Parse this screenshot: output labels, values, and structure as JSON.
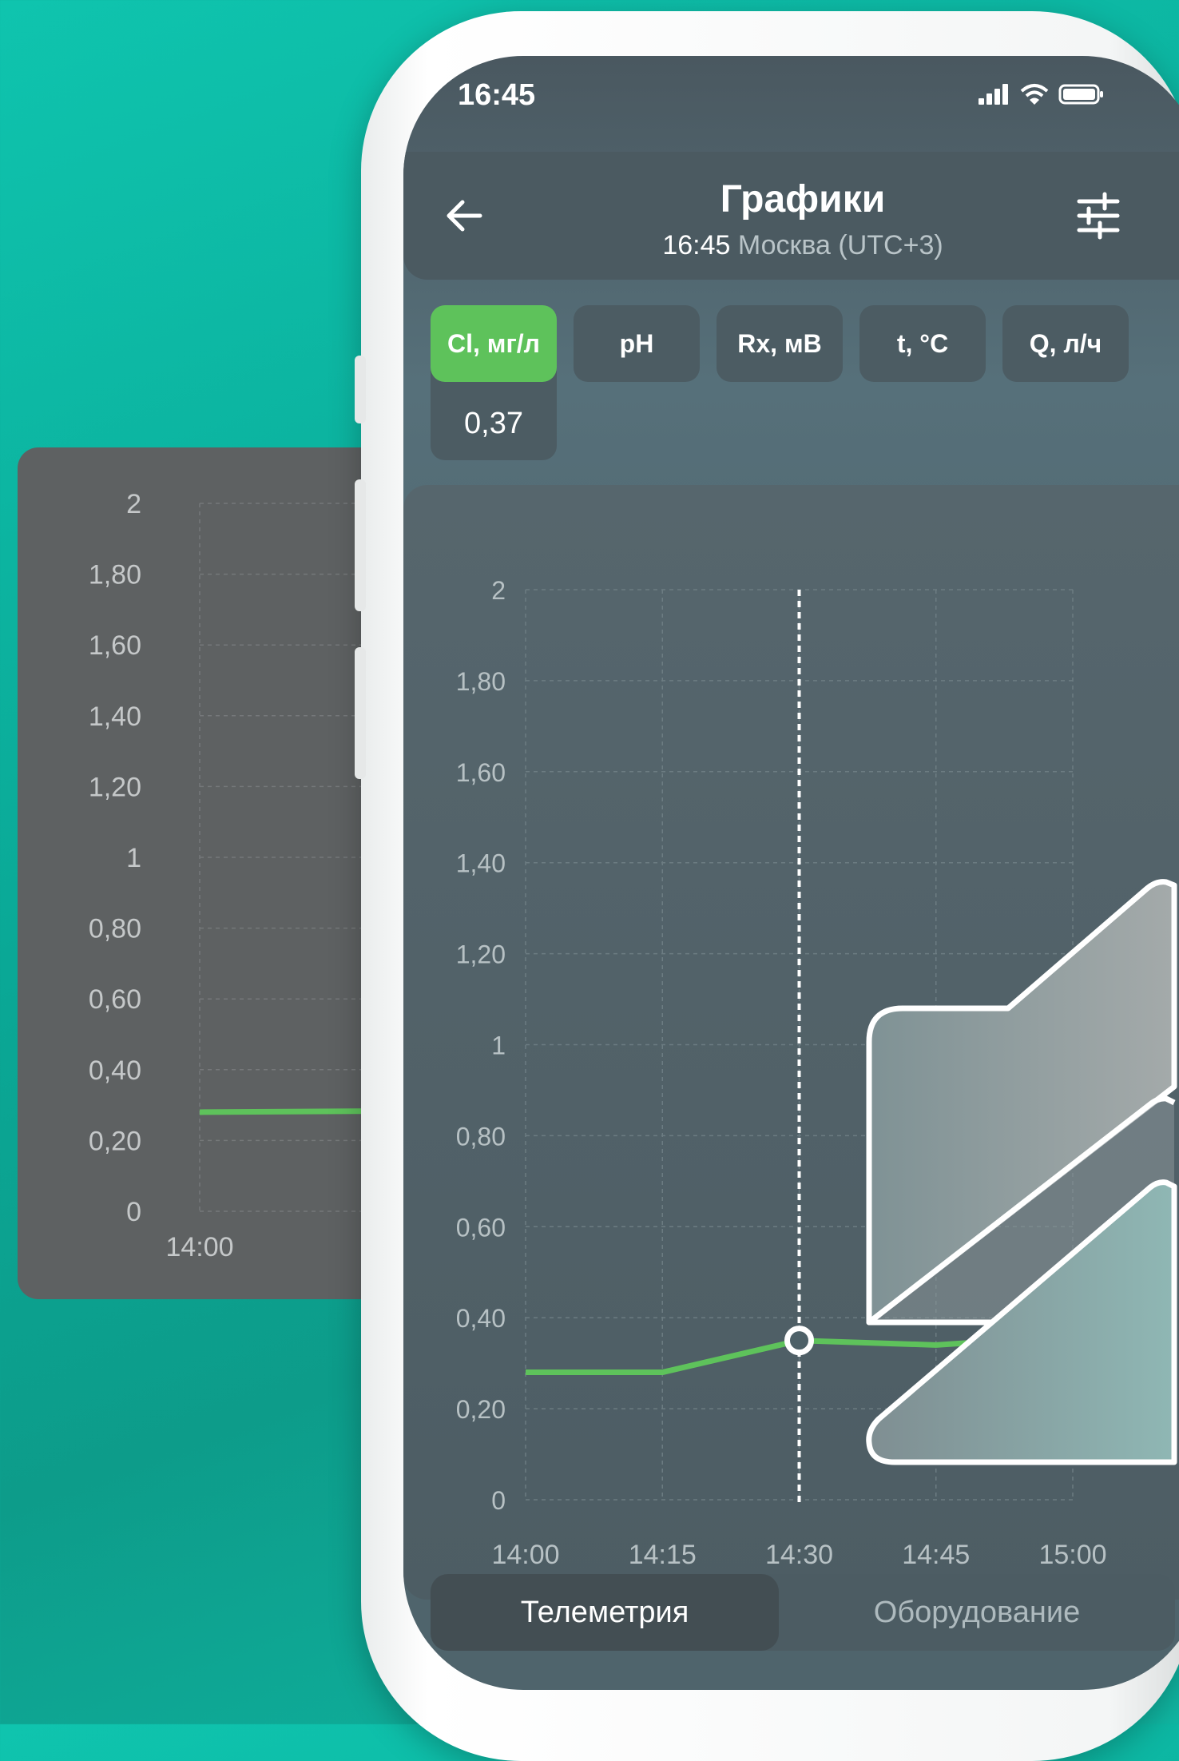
{
  "status_bar": {
    "time": "16:45"
  },
  "header": {
    "title": "Графики",
    "subtitle_time": "16:45",
    "subtitle_zone": "Москва (UTC+3)"
  },
  "tabs": [
    {
      "label": "Cl, мг/л",
      "active": true
    },
    {
      "label": "pH",
      "active": false
    },
    {
      "label": "Rx, мВ",
      "active": false
    },
    {
      "label": "t, °C",
      "active": false
    },
    {
      "label": "Q, л/ч",
      "active": false
    }
  ],
  "current_value": "0,37",
  "bottom_nav": {
    "telemetry": "Телеметрия",
    "equipment": "Оборудование"
  },
  "colors": {
    "accent": "#5ec25b",
    "background": "#0aa896"
  },
  "chart_data": {
    "type": "line",
    "x": [
      "14:00",
      "14:15",
      "14:30",
      "14:45",
      "15:00"
    ],
    "series": [
      {
        "values": [
          0.28,
          0.28,
          0.35,
          0.34,
          0.36
        ]
      }
    ],
    "y_ticks": [
      "0",
      "0,20",
      "0,40",
      "0,60",
      "0,80",
      "1",
      "1,20",
      "1,40",
      "1,60",
      "1,80",
      "2"
    ],
    "ylim": [
      0,
      2
    ],
    "grid": true,
    "cursor_x": "14:30"
  },
  "background_chart": {
    "y_ticks": [
      "0",
      "0,20",
      "0,40",
      "0,60",
      "0,80",
      "1",
      "1,20",
      "1,40",
      "1,60",
      "1,80",
      "2"
    ],
    "x_label": "14:00",
    "value": 0.28
  }
}
